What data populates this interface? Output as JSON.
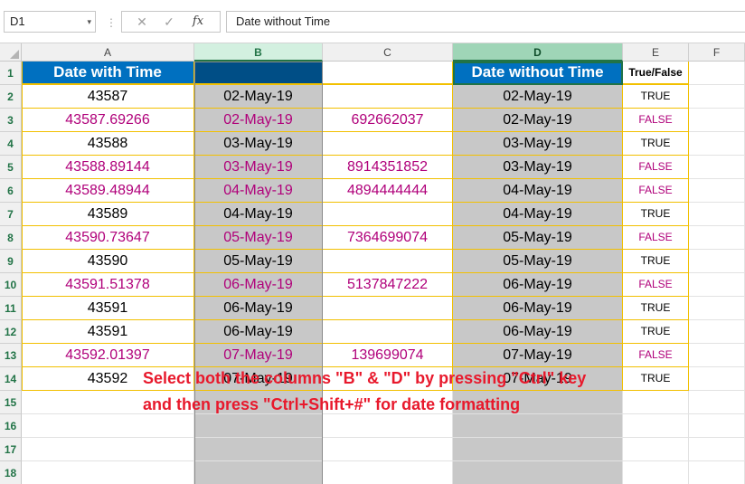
{
  "formula_bar": {
    "name_box": "D1",
    "name_box_arrow": "▾",
    "separator": "⋮",
    "cancel_icon": "✕",
    "confirm_icon": "✓",
    "fx_label": "fx",
    "formula": "Date without Time"
  },
  "columns": [
    {
      "id": "A",
      "label": "A"
    },
    {
      "id": "B",
      "label": "B"
    },
    {
      "id": "C",
      "label": "C"
    },
    {
      "id": "D",
      "label": "D"
    },
    {
      "id": "E",
      "label": "E"
    },
    {
      "id": "F",
      "label": "F"
    }
  ],
  "row_numbers": [
    "1",
    "2",
    "3",
    "4",
    "5",
    "6",
    "7",
    "8",
    "9",
    "10",
    "11",
    "12",
    "13",
    "14",
    "15",
    "16",
    "17",
    "18"
  ],
  "header_row": {
    "A": "Date with Time",
    "B": "",
    "C": "",
    "D": "Date without Time",
    "E": "True/False"
  },
  "rows": [
    {
      "A": "43587",
      "B": "02-May-19",
      "C": "",
      "D": "02-May-19",
      "E": "TRUE",
      "highlight": false
    },
    {
      "A": "43587.69266",
      "B": "02-May-19",
      "C": "692662037",
      "D": "02-May-19",
      "E": "FALSE",
      "highlight": true
    },
    {
      "A": "43588",
      "B": "03-May-19",
      "C": "",
      "D": "03-May-19",
      "E": "TRUE",
      "highlight": false
    },
    {
      "A": "43588.89144",
      "B": "03-May-19",
      "C": "8914351852",
      "D": "03-May-19",
      "E": "FALSE",
      "highlight": true
    },
    {
      "A": "43589.48944",
      "B": "04-May-19",
      "C": "4894444444",
      "D": "04-May-19",
      "E": "FALSE",
      "highlight": true
    },
    {
      "A": "43589",
      "B": "04-May-19",
      "C": "",
      "D": "04-May-19",
      "E": "TRUE",
      "highlight": false
    },
    {
      "A": "43590.73647",
      "B": "05-May-19",
      "C": "7364699074",
      "D": "05-May-19",
      "E": "FALSE",
      "highlight": true
    },
    {
      "A": "43590",
      "B": "05-May-19",
      "C": "",
      "D": "05-May-19",
      "E": "TRUE",
      "highlight": false
    },
    {
      "A": "43591.51378",
      "B": "06-May-19",
      "C": "5137847222",
      "D": "06-May-19",
      "E": "FALSE",
      "highlight": true
    },
    {
      "A": "43591",
      "B": "06-May-19",
      "C": "",
      "D": "06-May-19",
      "E": "TRUE",
      "highlight": false
    },
    {
      "A": "43591",
      "B": "06-May-19",
      "C": "",
      "D": "06-May-19",
      "E": "TRUE",
      "highlight": false
    },
    {
      "A": "43592.01397",
      "B": "07-May-19",
      "C": "139699074",
      "D": "07-May-19",
      "E": "FALSE",
      "highlight": true
    },
    {
      "A": "43592",
      "B": "07-May-19",
      "C": "",
      "D": "07-May-19",
      "E": "TRUE",
      "highlight": false
    }
  ],
  "note": {
    "line1": "Select both the columns \"B\" & \"D\" by pressing \"Ctrl\" key",
    "line2": "and then press \"Ctrl+Shift+#\" for date formatting"
  },
  "colors": {
    "header_fill": "#0070c0",
    "highlight_text": "#b0007a",
    "selection_fill": "#c8c8c8",
    "note_text": "#e8192c",
    "table_border": "#f2c000"
  }
}
